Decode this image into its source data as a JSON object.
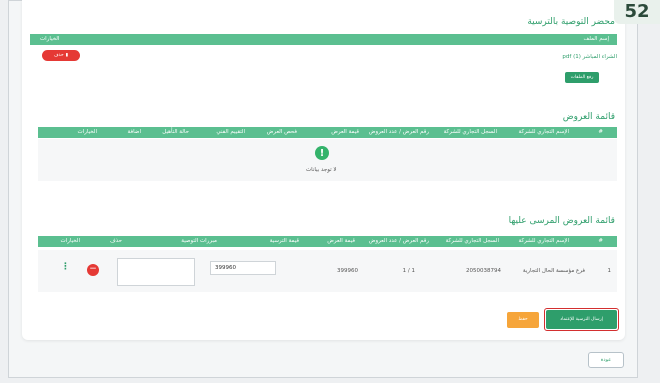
{
  "step_number": "52",
  "award_minutes": {
    "title": "محضر التوصية بالترسية",
    "header": {
      "file_name": "إسم الملف",
      "options": "الخيارات"
    },
    "file": {
      "name": "الشراء المباشر (1) pdf",
      "delete_label": "حذف"
    },
    "upload_label": "رفع الملفات"
  },
  "offers_list": {
    "title": "قائمة العروض",
    "headers": [
      "#",
      "الإسم التجاري للشركة",
      "السجل التجاري للشركة",
      "رقم العرض / عدد العروض",
      "قيمة العرض",
      "فحص العرض",
      "التقييم الفني",
      "حالة التأهيل",
      "اضافة",
      "الخيارات"
    ],
    "empty_text": "لا توجد بيانات"
  },
  "awarded_list": {
    "title": "قائمة العروض المرسى عليها",
    "headers": [
      "#",
      "الإسم التجاري للشركة",
      "السجل التجاري للشركة",
      "رقم العرض / عدد العروض",
      "قيمة العرض",
      "قيمة الترسية",
      "مبررات التوصية",
      "حذف",
      "الخيارات"
    ],
    "rows": [
      {
        "index": "1",
        "company": "فرع مؤسسة الحال التجارية",
        "cr": "2050038794",
        "offer_no": "1 / 1",
        "offer_value": "399960",
        "award_value": "399960",
        "justification": ""
      }
    ]
  },
  "actions": {
    "save_label": "حفظ",
    "send_label": "إرسال الترسية للإعتماد",
    "back_label": "عودة"
  },
  "colors": {
    "accent": "#2e9e6b",
    "header": "#5bbf90",
    "danger": "#e53935",
    "warning": "#f6a53a"
  }
}
